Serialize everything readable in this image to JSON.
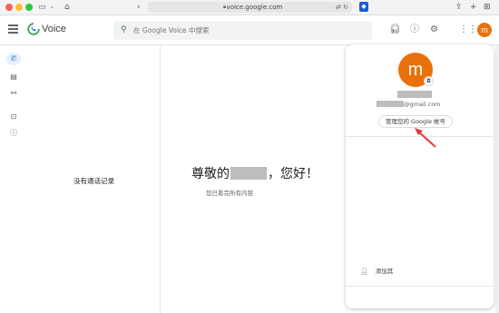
{
  "browser": {
    "url": "voice.google.com"
  },
  "app": {
    "name": "Voice",
    "search_placeholder": "在 Google Voice 中搜索",
    "avatar_letter": "m"
  },
  "list_pane": {
    "empty_text": "没有通话记录"
  },
  "main_pane": {
    "greeting_prefix": "尊敬的",
    "greeting_suffix": "，您好！",
    "subtext": "您已看完所有内容"
  },
  "account_popup": {
    "avatar_letter": "m",
    "email_suffix": "@gmail.com",
    "manage_button": "管理您的 Google 帐号",
    "add_account": "添加其"
  },
  "colors": {
    "avatar": "#e8710a",
    "accent_blue": "#1a73e8",
    "arrow": "#e53935"
  },
  "icons": [
    "menu-icon",
    "voice-logo-icon",
    "search-icon",
    "headset-icon",
    "help-icon",
    "settings-icon",
    "apps-grid-icon",
    "phone-icon",
    "message-icon",
    "voicemail-icon",
    "archive-icon",
    "spam-icon",
    "camera-icon",
    "add-person-icon"
  ]
}
